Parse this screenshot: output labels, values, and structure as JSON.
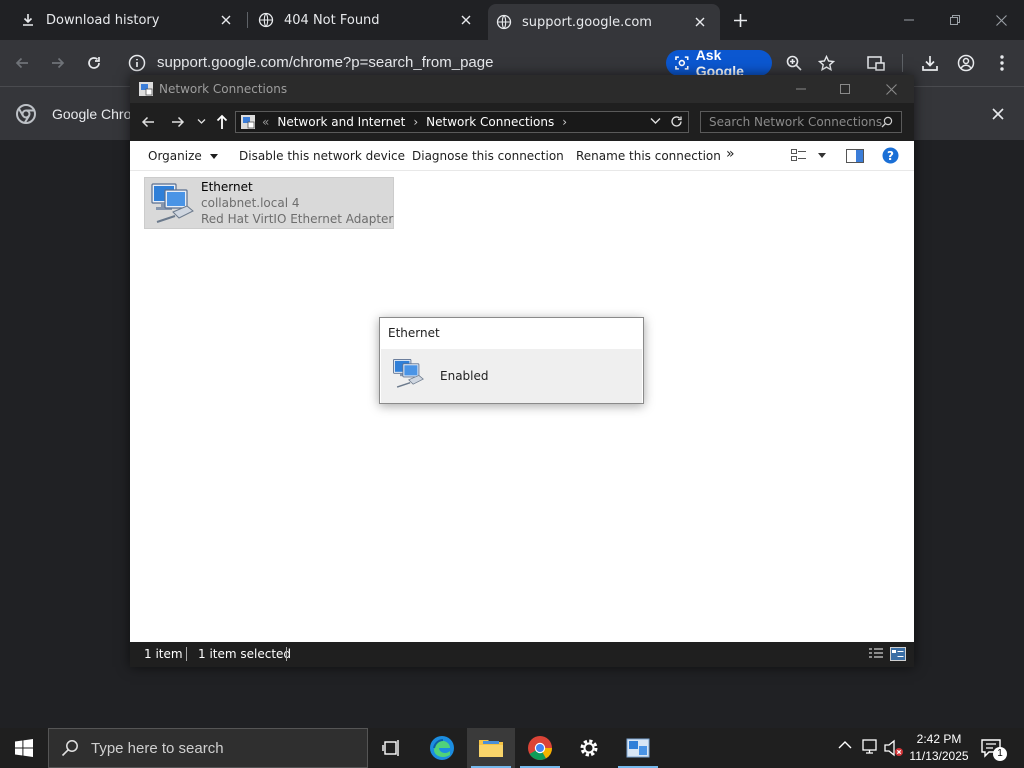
{
  "browser": {
    "tabs": [
      {
        "title": "Download history",
        "icon": "download-icon"
      },
      {
        "title": "404 Not Found",
        "icon": "globe-icon"
      },
      {
        "title": "support.google.com",
        "icon": "globe-icon",
        "active": true
      }
    ],
    "url": "support.google.com/chrome?p=search_from_page",
    "ask_google_label": "Ask Google",
    "infobar_text": "Google Chrom"
  },
  "explorer": {
    "title": "Network Connections",
    "breadcrumb": [
      "Network and Internet",
      "Network Connections"
    ],
    "search_placeholder": "Search Network Connections",
    "commands": {
      "organize": "Organize",
      "disable": "Disable this network device",
      "diagnose": "Diagnose this connection",
      "rename": "Rename this connection",
      "more": "»"
    },
    "items": [
      {
        "name": "Ethernet",
        "network": "collabnet.local 4",
        "adapter": "Red Hat VirtIO Ethernet Adapter"
      }
    ],
    "status": {
      "count": "1 item",
      "selected": "1 item selected"
    }
  },
  "popup": {
    "title": "Ethernet",
    "status": "Enabled"
  },
  "taskbar": {
    "search_placeholder": "Type here to search",
    "time": "2:42 PM",
    "date": "11/13/2025",
    "notification_count": "1"
  },
  "colors": {
    "chrome_bg": "#202124",
    "chrome_toolbar": "#35363a",
    "ask_google_blue": "#0b57d0",
    "explorer_dark": "#1f1f1f",
    "selection_gray": "#d9d9d9",
    "taskbar_bg": "#1f1f1f"
  }
}
